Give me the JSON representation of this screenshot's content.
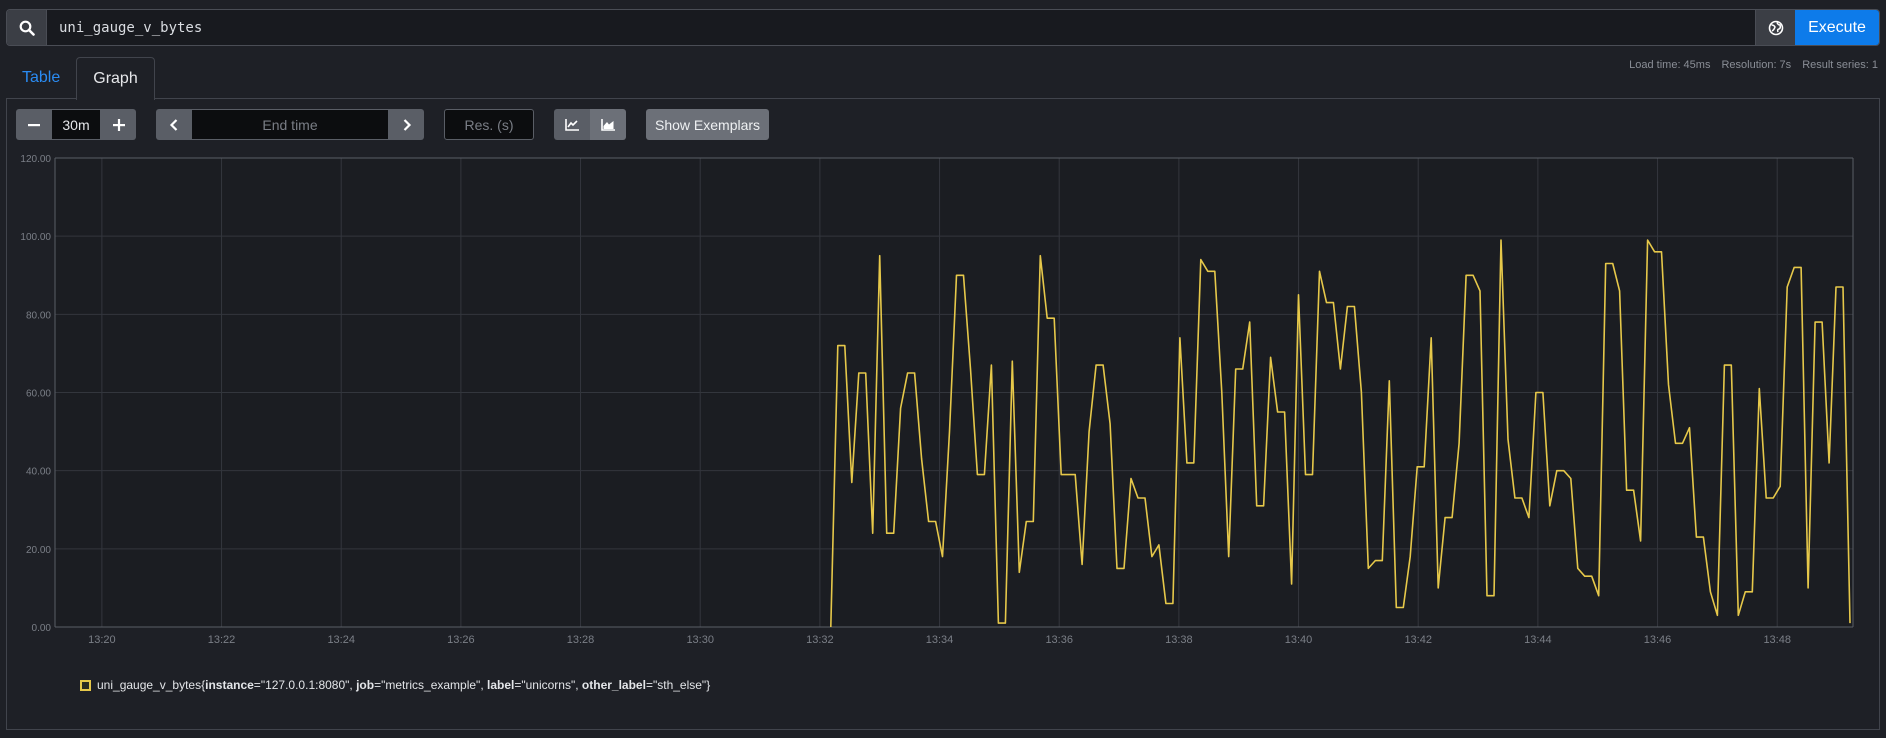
{
  "query": {
    "value": "uni_gauge_v_bytes",
    "execute_label": "Execute"
  },
  "icons": {
    "search": "search-icon",
    "globe": "globe-icon",
    "minus": "minus-icon",
    "plus": "plus-icon",
    "chev_left": "chevron-left-icon",
    "chev_right": "chevron-right-icon",
    "line": "line-chart-icon",
    "stacked": "stacked-chart-icon"
  },
  "tabs": [
    {
      "label": "Table",
      "active": false
    },
    {
      "label": "Graph",
      "active": true
    }
  ],
  "stats": {
    "load_time": "Load time: 45ms",
    "resolution": "Resolution: 7s",
    "result_series": "Result series: 1"
  },
  "controls": {
    "range": "30m",
    "end_time_placeholder": "End time",
    "res_placeholder": "Res. (s)",
    "exemplars_label": "Show Exemplars"
  },
  "colors": {
    "series": "#e6c84a",
    "accent": "#0d7bea",
    "grid": "#33363d"
  },
  "chart_data": {
    "type": "line",
    "ylim": [
      0,
      120
    ],
    "yticks": [
      "0.00",
      "20.00",
      "40.00",
      "60.00",
      "80.00",
      "100.00",
      "120.00"
    ],
    "xticks": [
      "13:20",
      "13:22",
      "13:24",
      "13:26",
      "13:28",
      "13:30",
      "13:32",
      "13:34",
      "13:36",
      "13:38",
      "13:40",
      "13:42",
      "13:44",
      "13:46",
      "13:48"
    ],
    "x_start": "13:19:13",
    "x_end": "13:49:16",
    "grid": true,
    "series": [
      {
        "name": "uni_gauge_v_bytes{instance=\"127.0.0.1:8080\", job=\"metrics_example\", label=\"unicorns\", other_label=\"sth_else\"}",
        "points": [
          [
            "13:32:11",
            0
          ],
          [
            "13:32:18",
            72
          ],
          [
            "13:32:25",
            72
          ],
          [
            "13:32:32",
            37
          ],
          [
            "13:32:39",
            65
          ],
          [
            "13:32:46",
            65
          ],
          [
            "13:32:53",
            24
          ],
          [
            "13:33:00",
            95
          ],
          [
            "13:33:07",
            24
          ],
          [
            "13:33:14",
            24
          ],
          [
            "13:33:21",
            56
          ],
          [
            "13:33:28",
            65
          ],
          [
            "13:33:35",
            65
          ],
          [
            "13:33:42",
            43
          ],
          [
            "13:33:49",
            27
          ],
          [
            "13:33:56",
            27
          ],
          [
            "13:34:03",
            18
          ],
          [
            "13:34:10",
            50
          ],
          [
            "13:34:17",
            90
          ],
          [
            "13:34:24",
            90
          ],
          [
            "13:34:31",
            66
          ],
          [
            "13:34:38",
            39
          ],
          [
            "13:34:45",
            39
          ],
          [
            "13:34:52",
            67
          ],
          [
            "13:34:59",
            1
          ],
          [
            "13:35:06",
            1
          ],
          [
            "13:35:13",
            68
          ],
          [
            "13:35:20",
            14
          ],
          [
            "13:35:27",
            27
          ],
          [
            "13:35:34",
            27
          ],
          [
            "13:35:41",
            95
          ],
          [
            "13:35:48",
            79
          ],
          [
            "13:35:55",
            79
          ],
          [
            "13:36:02",
            39
          ],
          [
            "13:36:09",
            39
          ],
          [
            "13:36:16",
            39
          ],
          [
            "13:36:23",
            16
          ],
          [
            "13:36:30",
            50
          ],
          [
            "13:36:37",
            67
          ],
          [
            "13:36:44",
            67
          ],
          [
            "13:36:51",
            52
          ],
          [
            "13:36:58",
            15
          ],
          [
            "13:37:05",
            15
          ],
          [
            "13:37:12",
            38
          ],
          [
            "13:37:19",
            33
          ],
          [
            "13:37:26",
            33
          ],
          [
            "13:37:33",
            18
          ],
          [
            "13:37:40",
            21
          ],
          [
            "13:37:47",
            6
          ],
          [
            "13:37:54",
            6
          ],
          [
            "13:38:01",
            74
          ],
          [
            "13:38:08",
            42
          ],
          [
            "13:38:15",
            42
          ],
          [
            "13:38:22",
            94
          ],
          [
            "13:38:29",
            91
          ],
          [
            "13:38:36",
            91
          ],
          [
            "13:38:43",
            60
          ],
          [
            "13:38:50",
            18
          ],
          [
            "13:38:57",
            66
          ],
          [
            "13:39:04",
            66
          ],
          [
            "13:39:11",
            78
          ],
          [
            "13:39:18",
            31
          ],
          [
            "13:39:25",
            31
          ],
          [
            "13:39:32",
            69
          ],
          [
            "13:39:39",
            55
          ],
          [
            "13:39:46",
            55
          ],
          [
            "13:39:53",
            11
          ],
          [
            "13:40:00",
            85
          ],
          [
            "13:40:07",
            39
          ],
          [
            "13:40:14",
            39
          ],
          [
            "13:40:21",
            91
          ],
          [
            "13:40:28",
            83
          ],
          [
            "13:40:35",
            83
          ],
          [
            "13:40:42",
            66
          ],
          [
            "13:40:49",
            82
          ],
          [
            "13:40:56",
            82
          ],
          [
            "13:41:03",
            60
          ],
          [
            "13:41:10",
            15
          ],
          [
            "13:41:17",
            17
          ],
          [
            "13:41:24",
            17
          ],
          [
            "13:41:31",
            63
          ],
          [
            "13:41:38",
            5
          ],
          [
            "13:41:45",
            5
          ],
          [
            "13:41:52",
            18
          ],
          [
            "13:41:59",
            41
          ],
          [
            "13:42:06",
            41
          ],
          [
            "13:42:13",
            74
          ],
          [
            "13:42:20",
            10
          ],
          [
            "13:42:27",
            28
          ],
          [
            "13:42:34",
            28
          ],
          [
            "13:42:41",
            47
          ],
          [
            "13:42:48",
            90
          ],
          [
            "13:42:55",
            90
          ],
          [
            "13:43:02",
            86
          ],
          [
            "13:43:09",
            8
          ],
          [
            "13:43:16",
            8
          ],
          [
            "13:43:23",
            99
          ],
          [
            "13:43:30",
            48
          ],
          [
            "13:43:37",
            33
          ],
          [
            "13:43:44",
            33
          ],
          [
            "13:43:51",
            28
          ],
          [
            "13:43:58",
            60
          ],
          [
            "13:44:05",
            60
          ],
          [
            "13:44:12",
            31
          ],
          [
            "13:44:19",
            40
          ],
          [
            "13:44:26",
            40
          ],
          [
            "13:44:33",
            38
          ],
          [
            "13:44:40",
            15
          ],
          [
            "13:44:47",
            13
          ],
          [
            "13:44:54",
            13
          ],
          [
            "13:45:01",
            8
          ],
          [
            "13:45:08",
            93
          ],
          [
            "13:45:15",
            93
          ],
          [
            "13:45:22",
            86
          ],
          [
            "13:45:29",
            35
          ],
          [
            "13:45:36",
            35
          ],
          [
            "13:45:43",
            22
          ],
          [
            "13:45:50",
            99
          ],
          [
            "13:45:57",
            96
          ],
          [
            "13:46:04",
            96
          ],
          [
            "13:46:11",
            62
          ],
          [
            "13:46:18",
            47
          ],
          [
            "13:46:25",
            47
          ],
          [
            "13:46:32",
            51
          ],
          [
            "13:46:39",
            23
          ],
          [
            "13:46:46",
            23
          ],
          [
            "13:46:53",
            9
          ],
          [
            "13:47:00",
            3
          ],
          [
            "13:47:07",
            67
          ],
          [
            "13:47:14",
            67
          ],
          [
            "13:47:21",
            3
          ],
          [
            "13:47:28",
            9
          ],
          [
            "13:47:35",
            9
          ],
          [
            "13:47:42",
            61
          ],
          [
            "13:47:49",
            33
          ],
          [
            "13:47:56",
            33
          ],
          [
            "13:48:03",
            36
          ],
          [
            "13:48:10",
            87
          ],
          [
            "13:48:17",
            92
          ],
          [
            "13:48:24",
            92
          ],
          [
            "13:48:31",
            10
          ],
          [
            "13:48:38",
            78
          ],
          [
            "13:48:45",
            78
          ],
          [
            "13:48:52",
            42
          ],
          [
            "13:48:59",
            87
          ],
          [
            "13:49:06",
            87
          ],
          [
            "13:49:13",
            1
          ]
        ]
      }
    ]
  },
  "legend": {
    "metric": "uni_gauge_v_bytes",
    "labels": [
      {
        "key": "instance",
        "value": "\"127.0.0.1:8080\""
      },
      {
        "key": "job",
        "value": "\"metrics_example\""
      },
      {
        "key": "label",
        "value": "\"unicorns\""
      },
      {
        "key": "other_label",
        "value": "\"sth_else\""
      }
    ]
  }
}
